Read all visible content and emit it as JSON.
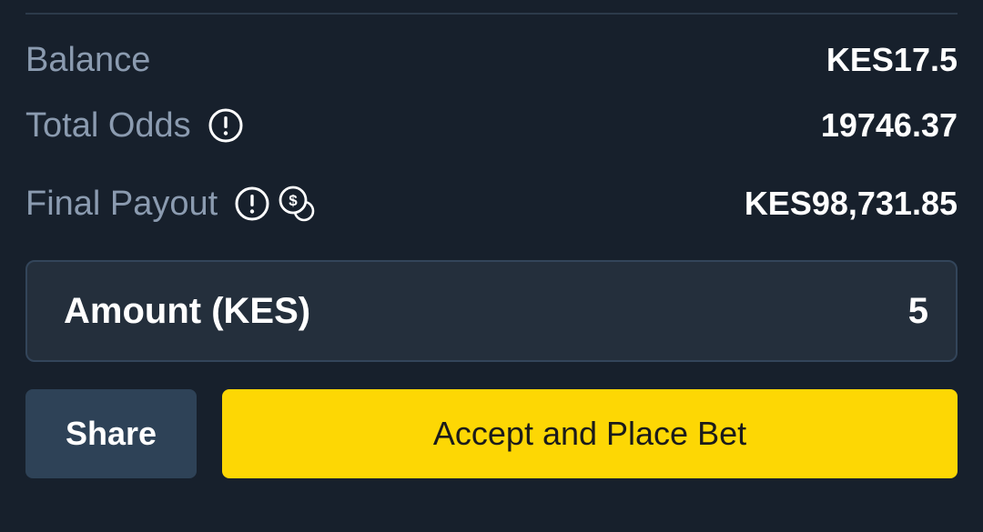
{
  "summary": {
    "balance": {
      "label": "Balance",
      "value": "KES17.5"
    },
    "total_odds": {
      "label": "Total Odds",
      "value": "19746.37",
      "icon": "info-icon"
    },
    "final_payout": {
      "label": "Final Payout",
      "value": "KES98,731.85",
      "icons": [
        "info-icon",
        "coin-icon"
      ]
    }
  },
  "amount": {
    "label": "Amount (KES)",
    "value": "5"
  },
  "actions": {
    "share_label": "Share",
    "place_label": "Accept and Place Bet"
  },
  "colors": {
    "background": "#17202c",
    "label": "#8b9bb0",
    "accent": "#fdd704",
    "share_button": "#2e4257",
    "input_background": "#242f3c"
  }
}
